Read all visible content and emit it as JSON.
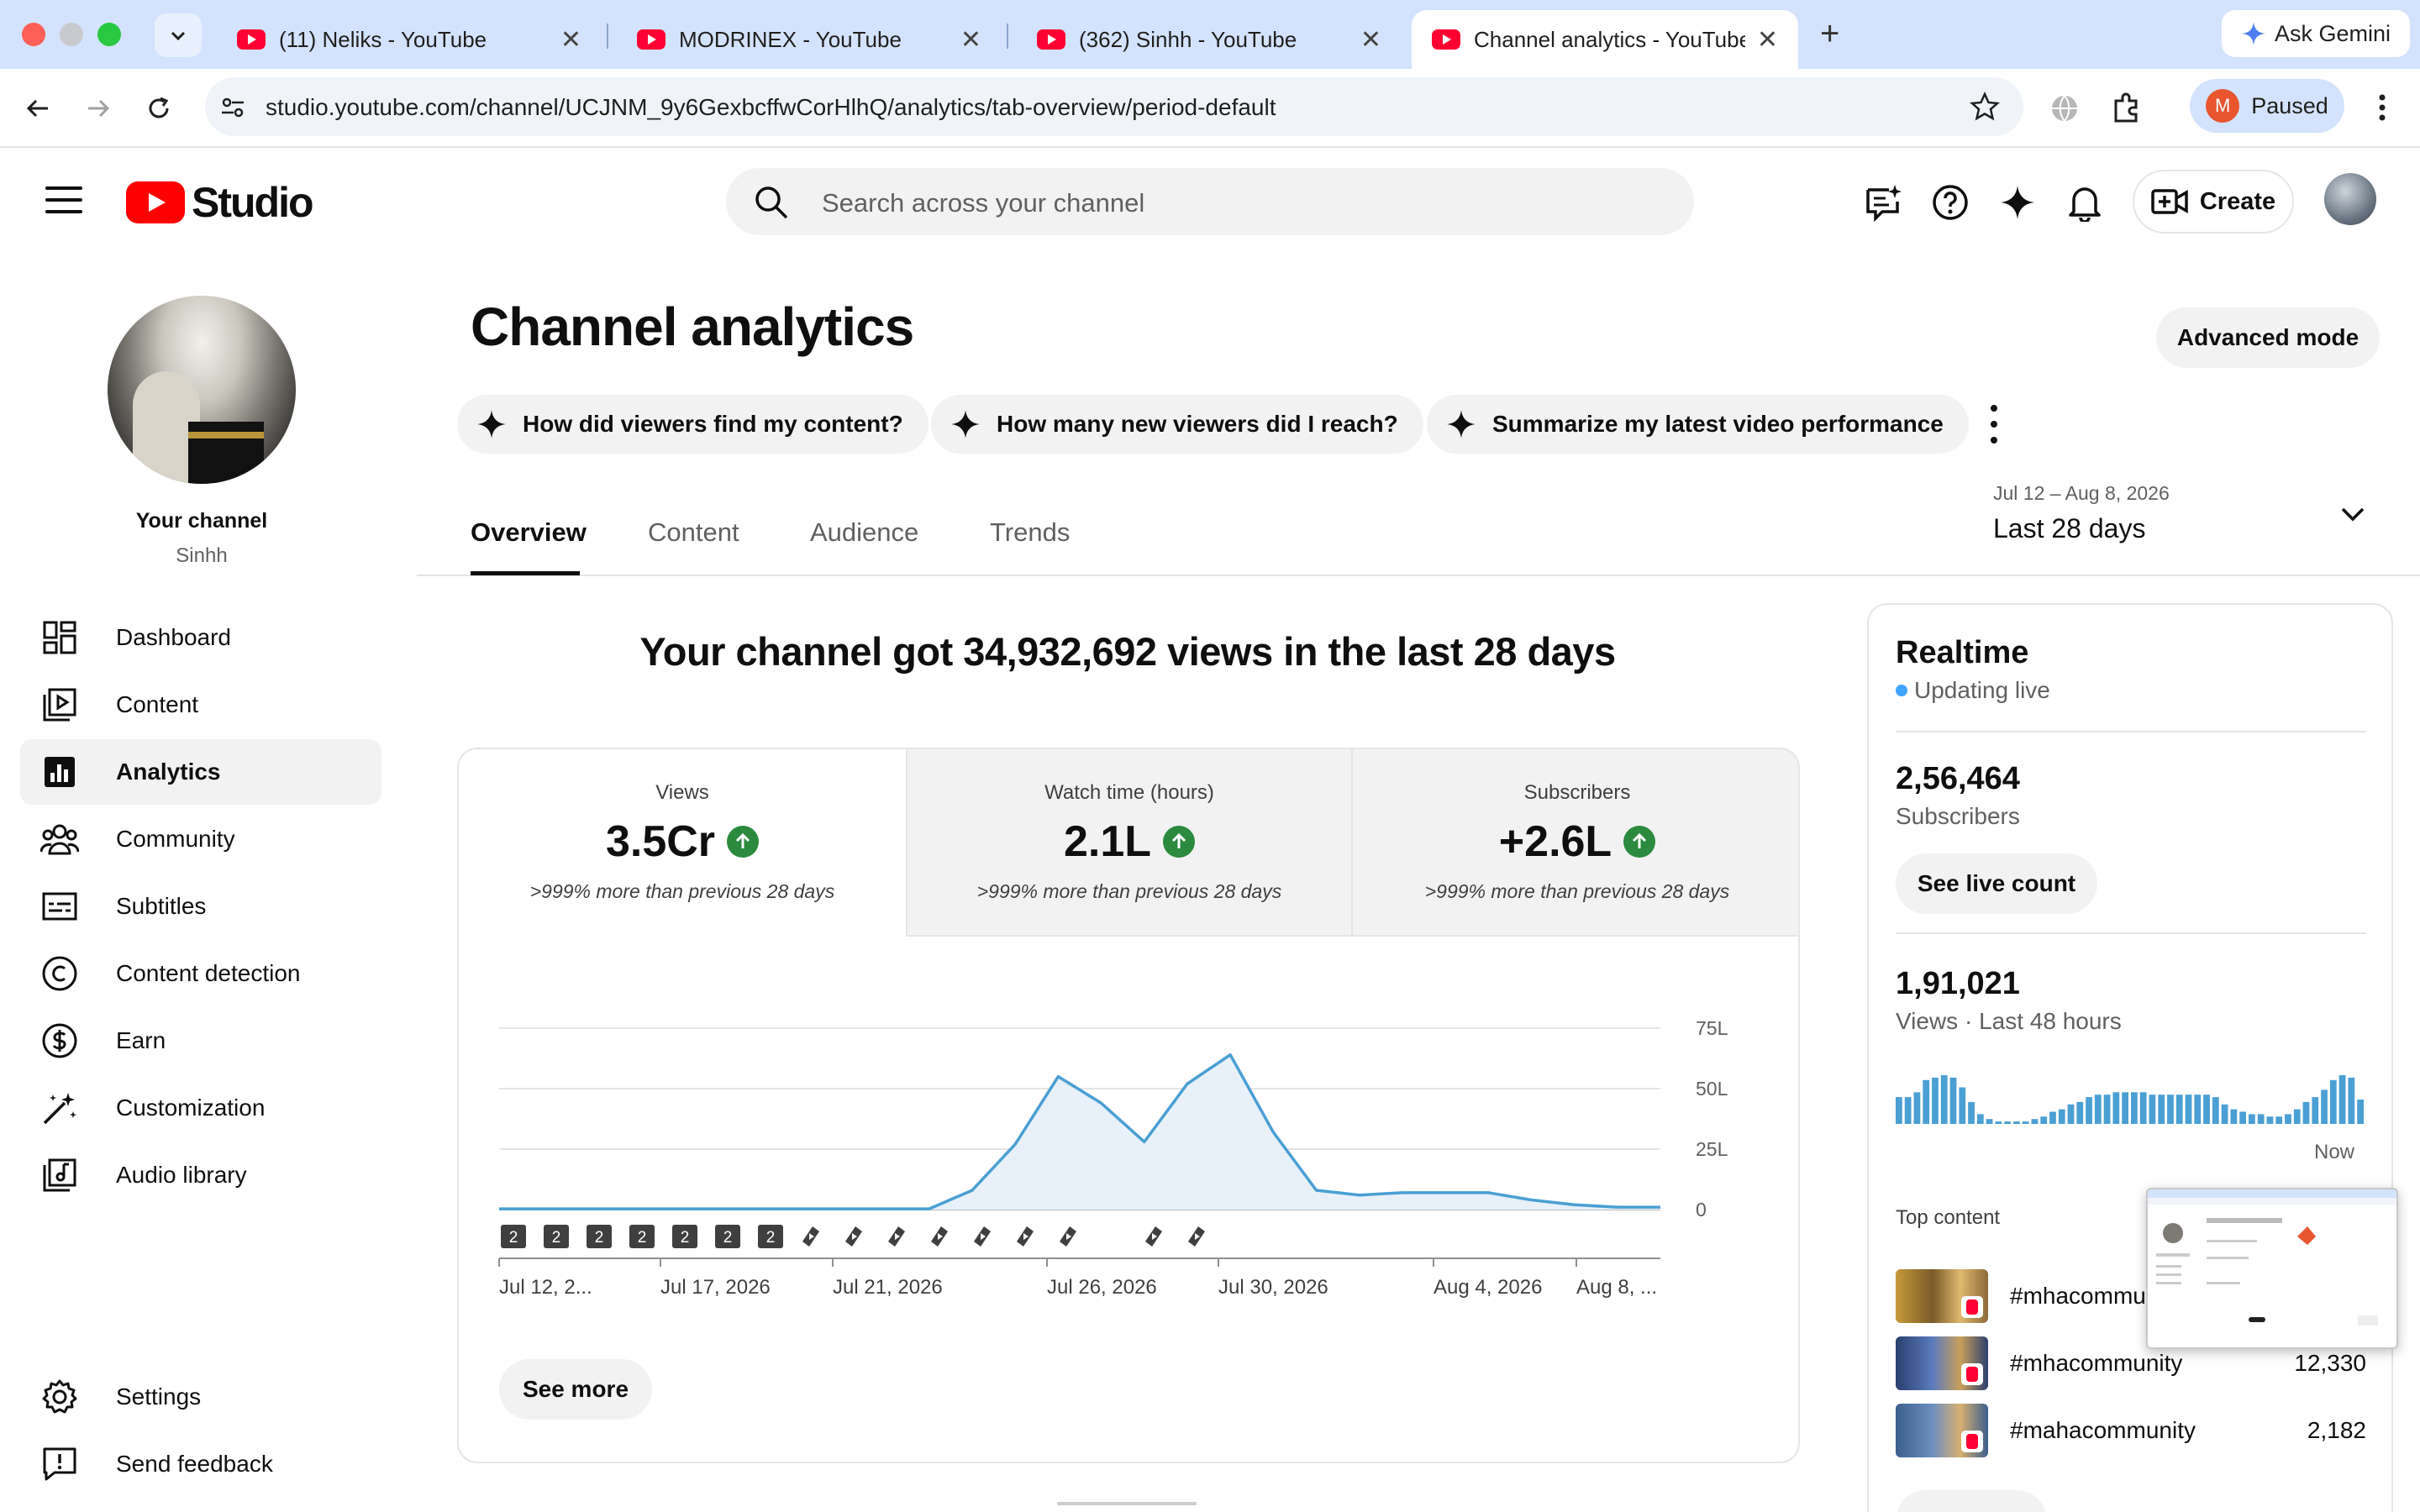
{
  "browser": {
    "tabs": [
      {
        "title": "(11) Neliks - YouTube",
        "close": "✕"
      },
      {
        "title": "MODRINEX - YouTube",
        "close": "✕"
      },
      {
        "title": "(362) Sinhh - YouTube",
        "close": "✕"
      },
      {
        "title": "Channel analytics - YouTube Studio",
        "close": "✕"
      }
    ],
    "gemini_label": "Ask Gemini",
    "url": "studio.youtube.com/channel/UCJNM_9y6GexbcffwCorHlhQ/analytics/tab-overview/period-default",
    "profile_initial": "M",
    "profile_status": "Paused"
  },
  "header": {
    "logo_text": "Studio",
    "search_placeholder": "Search across your channel",
    "create_label": "Create"
  },
  "sidebar": {
    "your_channel": "Your channel",
    "channel_name": "Sinhh",
    "items": [
      {
        "label": "Dashboard",
        "icon": "dashboard-icon"
      },
      {
        "label": "Content",
        "icon": "content-icon"
      },
      {
        "label": "Analytics",
        "icon": "analytics-icon",
        "active": true
      },
      {
        "label": "Community",
        "icon": "community-icon"
      },
      {
        "label": "Subtitles",
        "icon": "subtitles-icon"
      },
      {
        "label": "Content detection",
        "icon": "copyright-icon"
      },
      {
        "label": "Earn",
        "icon": "dollar-icon"
      },
      {
        "label": "Customization",
        "icon": "magic-wand-icon"
      },
      {
        "label": "Audio library",
        "icon": "audio-library-icon"
      }
    ],
    "bottom_items": [
      {
        "label": "Settings",
        "icon": "gear-icon"
      },
      {
        "label": "Send feedback",
        "icon": "feedback-icon"
      }
    ]
  },
  "main": {
    "title": "Channel analytics",
    "advanced_mode": "Advanced mode",
    "chips": [
      "How did viewers find my content?",
      "How many new viewers did I reach?",
      "Summarize my latest video performance"
    ],
    "tabs": [
      "Overview",
      "Content",
      "Audience",
      "Trends"
    ],
    "date_range_sub": "Jul 12 – Aug 8, 2026",
    "date_range_main": "Last 28 days",
    "headline": "Your channel got 34,932,692 views in the last 28 days",
    "metrics": [
      {
        "title": "Views",
        "value": "3.5Cr",
        "compare": ">999% more than previous 28 days"
      },
      {
        "title": "Watch time (hours)",
        "value": "2.1L",
        "compare": ">999% more than previous 28 days"
      },
      {
        "title": "Subscribers",
        "value": "+2.6L",
        "compare": ">999% more than previous 28 days"
      }
    ],
    "see_more": "See more",
    "upload_marker_text": "2"
  },
  "chart_data": {
    "type": "area",
    "x_tick_labels": [
      "Jul 12, 2...",
      "Jul 17, 2026",
      "Jul 21, 2026",
      "Jul 26, 2026",
      "Jul 30, 2026",
      "Aug 4, 2026",
      "Aug 8, ..."
    ],
    "y_tick_labels": [
      "75L",
      "50L",
      "25L",
      "0"
    ],
    "ylim": [
      0,
      75
    ],
    "y_unit": "L",
    "series": [
      {
        "values": [
          0.3,
          0.3,
          0.3,
          0.3,
          0.3,
          0.3,
          0.3,
          0.3,
          0.3,
          0.3,
          0.3,
          8,
          27,
          55,
          44,
          28,
          52,
          64,
          32,
          8,
          6,
          7,
          7,
          7,
          4,
          2,
          1,
          1
        ]
      }
    ],
    "color": "#4a9fd4",
    "fill": "#e8f1f9",
    "grid": true,
    "markers": [
      "2",
      "2",
      "2",
      "2",
      "2",
      "2",
      "2",
      "short",
      "short",
      "short",
      "short",
      "short",
      "short",
      "short",
      "",
      "short",
      "short"
    ]
  },
  "realtime": {
    "title": "Realtime",
    "live_label": "Updating live",
    "subscribers_value": "2,56,464",
    "subscribers_label": "Subscribers",
    "see_live_count": "See live count",
    "views_value": "1,91,021",
    "views_label": "Views · Last 48 hours",
    "now_label": "Now",
    "bars": [
      0.55,
      0.55,
      0.65,
      0.9,
      0.95,
      1.0,
      0.95,
      0.75,
      0.45,
      0.2,
      0.1,
      0.05,
      0.05,
      0.05,
      0.05,
      0.1,
      0.15,
      0.25,
      0.3,
      0.4,
      0.45,
      0.55,
      0.6,
      0.6,
      0.65,
      0.65,
      0.65,
      0.65,
      0.6,
      0.6,
      0.6,
      0.6,
      0.6,
      0.6,
      0.6,
      0.55,
      0.4,
      0.3,
      0.25,
      0.2,
      0.2,
      0.15,
      0.15,
      0.2,
      0.3,
      0.45,
      0.55,
      0.7,
      0.9,
      1.0,
      0.95,
      0.5
    ],
    "top_content_label": "Top content",
    "top_content": [
      {
        "title": "#mhacommunity",
        "value": ""
      },
      {
        "title": "#mhacommunity",
        "value": "12,330"
      },
      {
        "title": "#mahacommunity",
        "value": "2,182"
      }
    ]
  }
}
